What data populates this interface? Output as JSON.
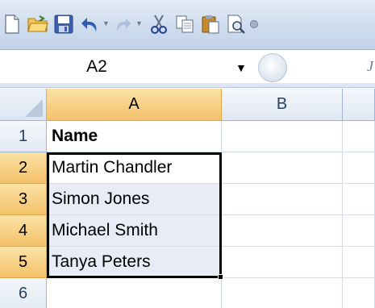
{
  "formula_bar": {
    "name_box_value": "A2",
    "edge_glyph": "J"
  },
  "columns": [
    "A",
    "B"
  ],
  "rows": [
    {
      "number": "1",
      "a": "Name",
      "b": ""
    },
    {
      "number": "2",
      "a": "Martin Chandler",
      "b": ""
    },
    {
      "number": "3",
      "a": "Simon Jones",
      "b": ""
    },
    {
      "number": "4",
      "a": "Michael Smith",
      "b": ""
    },
    {
      "number": "5",
      "a": "Tanya Peters",
      "b": ""
    },
    {
      "number": "6",
      "a": "",
      "b": ""
    }
  ],
  "selection": {
    "range_active_cell": "A2"
  },
  "colors": {
    "selected_header": "#f4c16a",
    "selected_cell_fill": "#e9ecf6",
    "toolbar_bg": "#cfdcee"
  }
}
